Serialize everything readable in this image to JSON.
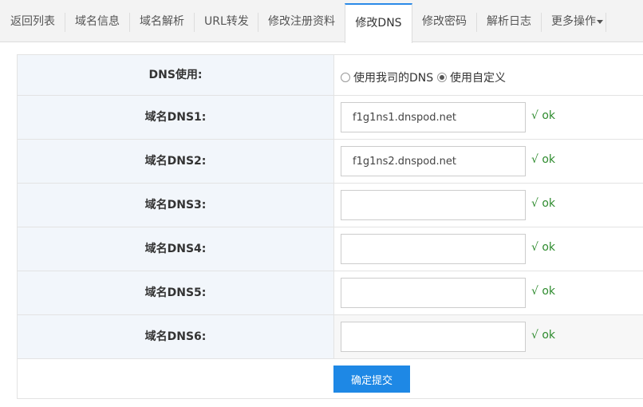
{
  "tabs": [
    {
      "label": "返回列表"
    },
    {
      "label": "域名信息"
    },
    {
      "label": "域名解析"
    },
    {
      "label": "URL转发"
    },
    {
      "label": "修改注册资料"
    },
    {
      "label": "修改DNS",
      "active": true
    },
    {
      "label": "修改密码"
    },
    {
      "label": "解析日志"
    },
    {
      "label": "更多操作"
    }
  ],
  "form": {
    "dns_usage_label": "DNS使用:",
    "option_my_dns": "使用我司的DNS",
    "option_custom": "使用自定义",
    "selected_option": "custom",
    "rows": [
      {
        "label": "域名DNS1:",
        "value": "f1g1ns1.dnspod.net",
        "status": "√ ok"
      },
      {
        "label": "域名DNS2:",
        "value": "f1g1ns2.dnspod.net",
        "status": "√ ok"
      },
      {
        "label": "域名DNS3:",
        "value": "",
        "status": "√ ok"
      },
      {
        "label": "域名DNS4:",
        "value": "",
        "status": "√ ok"
      },
      {
        "label": "域名DNS5:",
        "value": "",
        "status": "√ ok"
      },
      {
        "label": "域名DNS6:",
        "value": "",
        "status": "√ ok"
      }
    ],
    "submit_label": "确定提交"
  },
  "colors": {
    "accent": "#1e88e5",
    "ok_green": "#2e8b2e",
    "label_bg": "#f2f6fb"
  }
}
